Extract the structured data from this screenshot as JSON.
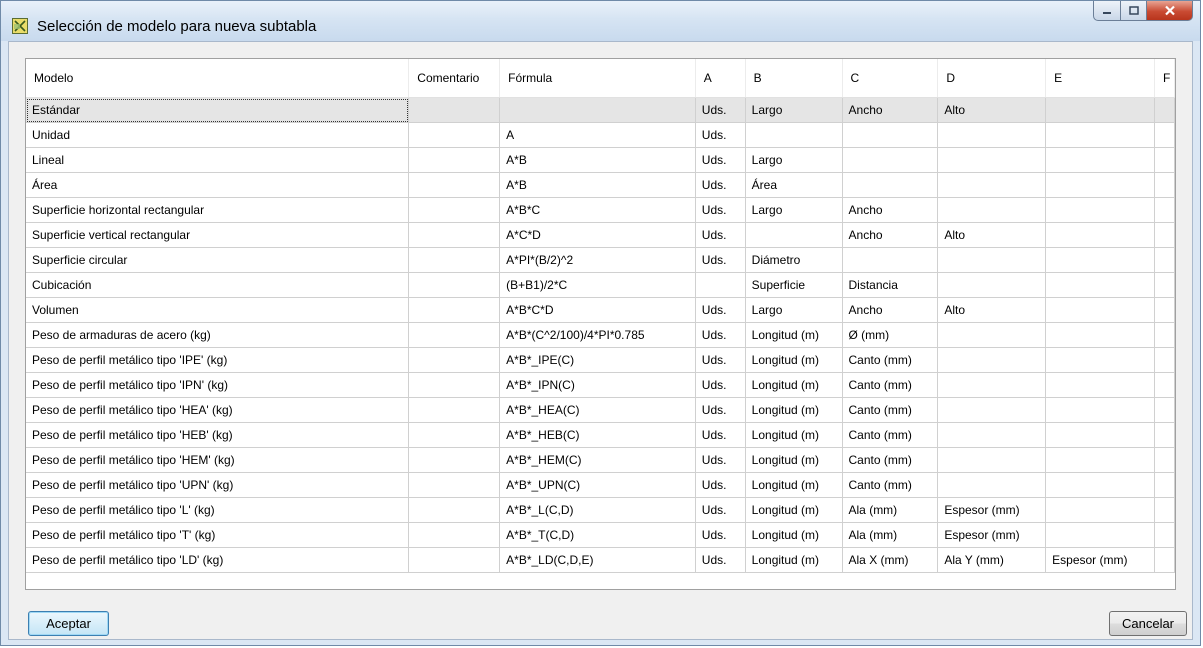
{
  "window": {
    "title": "Selección de modelo para nueva subtabla",
    "icons": {
      "app": "app-icon",
      "minimize": "minimize-icon",
      "maximize": "maximize-icon",
      "close": "close-icon"
    }
  },
  "table": {
    "headers": [
      "Modelo",
      "Comentario",
      "Fórmula",
      "A",
      "B",
      "C",
      "D",
      "E",
      "F"
    ],
    "selected_row": 0,
    "rows": [
      [
        "Estándar",
        "",
        "",
        "Uds.",
        "Largo",
        "Ancho",
        "Alto",
        "",
        ""
      ],
      [
        "Unidad",
        "",
        "A",
        "Uds.",
        "",
        "",
        "",
        "",
        ""
      ],
      [
        "Lineal",
        "",
        "A*B",
        "Uds.",
        "Largo",
        "",
        "",
        "",
        ""
      ],
      [
        "Área",
        "",
        "A*B",
        "Uds.",
        "Área",
        "",
        "",
        "",
        ""
      ],
      [
        "Superficie horizontal rectangular",
        "",
        "A*B*C",
        "Uds.",
        "Largo",
        "Ancho",
        "",
        "",
        ""
      ],
      [
        "Superficie vertical rectangular",
        "",
        "A*C*D",
        "Uds.",
        "",
        "Ancho",
        "Alto",
        "",
        ""
      ],
      [
        "Superficie circular",
        "",
        "A*PI*(B/2)^2",
        "Uds.",
        "Diámetro",
        "",
        "",
        "",
        ""
      ],
      [
        "Cubicación",
        "",
        "(B+B1)/2*C",
        "",
        "Superficie",
        "Distancia",
        "",
        "",
        ""
      ],
      [
        "Volumen",
        "",
        "A*B*C*D",
        "Uds.",
        "Largo",
        "Ancho",
        "Alto",
        "",
        ""
      ],
      [
        "Peso de armaduras de acero (kg)",
        "",
        "A*B*(C^2/100)/4*PI*0.785",
        "Uds.",
        "Longitud (m)",
        "Ø (mm)",
        "",
        "",
        ""
      ],
      [
        "Peso de perfil metálico tipo 'IPE' (kg)",
        "",
        "A*B*_IPE(C)",
        "Uds.",
        "Longitud (m)",
        "Canto (mm)",
        "",
        "",
        ""
      ],
      [
        "Peso de perfil metálico tipo 'IPN' (kg)",
        "",
        "A*B*_IPN(C)",
        "Uds.",
        "Longitud (m)",
        "Canto (mm)",
        "",
        "",
        ""
      ],
      [
        "Peso de perfil metálico tipo 'HEA' (kg)",
        "",
        "A*B*_HEA(C)",
        "Uds.",
        "Longitud (m)",
        "Canto (mm)",
        "",
        "",
        ""
      ],
      [
        "Peso de perfil metálico tipo 'HEB' (kg)",
        "",
        "A*B*_HEB(C)",
        "Uds.",
        "Longitud (m)",
        "Canto (mm)",
        "",
        "",
        ""
      ],
      [
        "Peso de perfil metálico tipo 'HEM' (kg)",
        "",
        "A*B*_HEM(C)",
        "Uds.",
        "Longitud (m)",
        "Canto (mm)",
        "",
        "",
        ""
      ],
      [
        "Peso de perfil metálico tipo 'UPN' (kg)",
        "",
        "A*B*_UPN(C)",
        "Uds.",
        "Longitud (m)",
        "Canto (mm)",
        "",
        "",
        ""
      ],
      [
        "Peso de perfil metálico tipo 'L' (kg)",
        "",
        "A*B*_L(C,D)",
        "Uds.",
        "Longitud (m)",
        "Ala (mm)",
        "Espesor (mm)",
        "",
        ""
      ],
      [
        "Peso de perfil metálico tipo 'T' (kg)",
        "",
        "A*B*_T(C,D)",
        "Uds.",
        "Longitud (m)",
        "Ala (mm)",
        "Espesor (mm)",
        "",
        ""
      ],
      [
        "Peso de perfil metálico tipo 'LD' (kg)",
        "",
        "A*B*_LD(C,D,E)",
        "Uds.",
        "Longitud (m)",
        "Ala X (mm)",
        "Ala Y (mm)",
        "Espesor (mm)",
        ""
      ]
    ]
  },
  "buttons": {
    "ok_label": "Aceptar",
    "cancel_label": "Cancelar"
  }
}
